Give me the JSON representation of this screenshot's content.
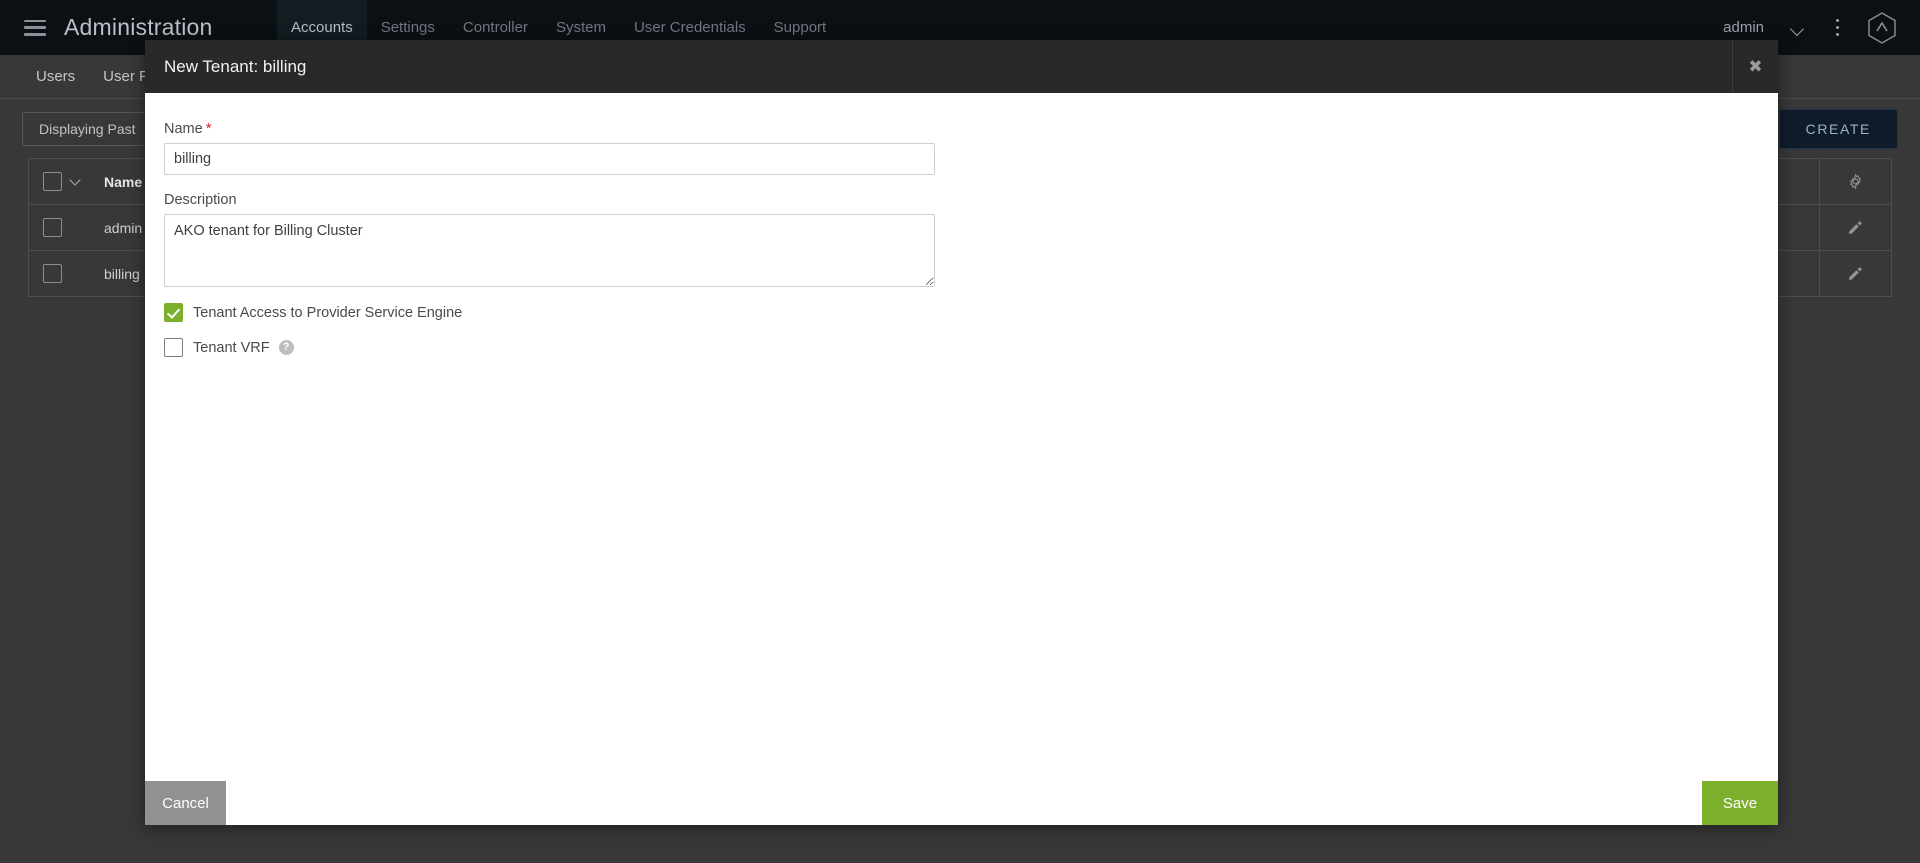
{
  "topnav": {
    "menu_icon": "hamburger-icon",
    "app_title": "Administration",
    "tabs": [
      {
        "label": "Accounts",
        "active": true
      },
      {
        "label": "Settings",
        "active": false
      },
      {
        "label": "Controller",
        "active": false
      },
      {
        "label": "System",
        "active": false
      },
      {
        "label": "User Credentials",
        "active": false
      },
      {
        "label": "Support",
        "active": false
      }
    ],
    "user": "admin",
    "chevron_icon": "chevron-down-icon",
    "overflow_icon": "vertical-dots-icon",
    "logo_icon": "avi-hexagon-logo-icon"
  },
  "subtabs": [
    {
      "label": "Users"
    },
    {
      "label": "User Profiles"
    }
  ],
  "toolbar": {
    "filter_label": "Displaying Past",
    "create_label": "CREATE"
  },
  "table": {
    "columns": [
      "Name"
    ],
    "header_gear_icon": "gear-icon",
    "rows": [
      {
        "name": "admin",
        "action_icon": "pencil-icon"
      },
      {
        "name": "billing",
        "action_icon": "pencil-icon"
      }
    ]
  },
  "modal": {
    "title": "New Tenant: billing",
    "close_icon": "close-icon",
    "name_field": {
      "label": "Name",
      "required_marker": "*",
      "value": "billing",
      "placeholder": ""
    },
    "description_field": {
      "label": "Description",
      "value": "AKO tenant for Billing Cluster",
      "placeholder": ""
    },
    "checkboxes": [
      {
        "label": "Tenant Access to Provider Service Engine",
        "checked": true,
        "help_icon": null
      },
      {
        "label": "Tenant VRF",
        "checked": false,
        "help_icon": "help-circle-icon",
        "help_glyph": "?"
      }
    ],
    "footer": {
      "cancel_label": "Cancel",
      "save_label": "Save"
    }
  },
  "colors": {
    "accent_green": "#7CB02C",
    "nav_dark": "#0a1014",
    "page_bg": "#383838",
    "modal_header": "#292929",
    "required_red": "#d81f2a",
    "cancel_gray": "#919191"
  }
}
